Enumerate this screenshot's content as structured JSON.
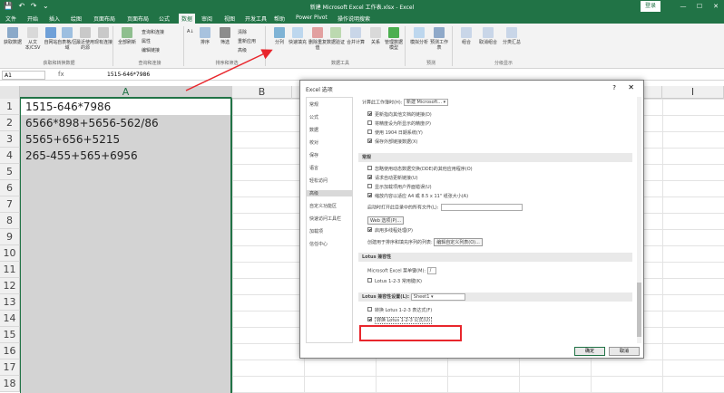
{
  "titlebar": {
    "quick_access": [
      "💾",
      "↶",
      "↷",
      "⌄"
    ],
    "title": "新建 Microsoft Excel 工作表.xlsx  -  Excel",
    "sign_in": "登录",
    "win_buttons": [
      "—",
      "☐",
      "✕"
    ]
  },
  "tabs": {
    "file": "文件",
    "home": "开始",
    "insert": "插入",
    "draw": "绘图",
    "layout": "页面布局",
    "formulas": "公式",
    "data": "数据",
    "review": "审阅",
    "view": "视图",
    "dev": "开发工具",
    "help": "帮助",
    "powerpivot": "Power Pivot",
    "tell": "操作说明搜索"
  },
  "ribbon": {
    "get_data": "获取数据",
    "from_text": "从文本/CSV",
    "from_web": "自网站",
    "from_table": "自表格/区域",
    "recent": "最近使用的源",
    "existing": "现有连接",
    "refresh_all": "全部刷新",
    "queries": "查询和连接",
    "properties": "属性",
    "edit_links": "编辑链接",
    "sort": "排序",
    "filter": "筛选",
    "clear": "清除",
    "reapply": "重新应用",
    "advanced": "高级",
    "text_to_columns": "分列",
    "flash_fill": "快速填充",
    "remove_dup": "删除重复值",
    "validation": "数据验证",
    "consolidate": "合并计算",
    "relationships": "关系",
    "data_model": "管理数据模型",
    "what_if": "模拟分析",
    "forecast_sheet": "预测工作表",
    "group": "组合",
    "ungroup": "取消组合",
    "subtotal": "分类汇总",
    "groups": {
      "get_transform": "获取和转换数据",
      "queries_conn": "查询和连接",
      "sort_filter": "排序和筛选",
      "data_tools": "数据工具",
      "forecast": "预测",
      "outline": "分级显示"
    }
  },
  "formula_bar": {
    "name_box": "A1",
    "fx": "fx",
    "formula": "1515-646*7986"
  },
  "sheet": {
    "columns": [
      "A",
      "B",
      "C",
      "D",
      "E",
      "F",
      "G",
      "H",
      "I"
    ],
    "rows": [
      "1",
      "2",
      "3",
      "4",
      "5",
      "6",
      "7",
      "8",
      "9",
      "10",
      "11",
      "12",
      "13",
      "14",
      "15",
      "16",
      "17",
      "18"
    ],
    "cells": [
      "1515-646*7986",
      "6566*898+5656-562/86",
      "5565+656+5215",
      "265-455+565+6956"
    ]
  },
  "dialog": {
    "title": "Excel 选项",
    "help": "?",
    "close": "✕",
    "nav": [
      "常规",
      "公式",
      "数据",
      "校对",
      "保存",
      "语言",
      "轻松访问",
      "高级",
      "自定义功能区",
      "快速访问工具栏",
      "加载项",
      "信任中心"
    ],
    "sections": {
      "calc_label": "计算此工作簿时(H):",
      "calc_book": "新建 Microsoft...",
      "calc_opts": [
        "更新指向其他文档的链接(D)",
        "将精度设为所显示的精度(P)",
        "使用 1904 日期系统(Y)",
        "保存外部链接数据(X)"
      ],
      "general": "常规",
      "general_opts": [
        "忽略使用动态数据交换(DDE)的其他应用程序(O)",
        "请求自动更新链接(U)",
        "显示加载项用户界面错误(U)",
        "缩放内容以适应 A4 或 8.5 x 11\" 纸张大小(A)"
      ],
      "startup_label": "启动时打开此目录中的所有文件(L):",
      "web_options": "Web 选项(P)...",
      "multithread": "启用多线程处理(P)",
      "custom_lists_label": "创建用于排序和填充序列的列表:",
      "custom_lists_btn": "编辑自定义列表(O)...",
      "lotus_compat": "Lotus 兼容性",
      "menu_key_label": "Microsoft Excel 菜单键(M):",
      "menu_key_val": "/",
      "lotus_nav": "Lotus 1-2-3 常用键(K)",
      "lotus_settings": "Lotus 兼容性设置(L):",
      "lotus_sheet": "Sheet1",
      "lotus_eval": "转换 Lotus 1-2-3 表达式(F)",
      "lotus_formula": "转换 Lotus 1-2-3 公式(U)"
    },
    "ok": "确定",
    "cancel": "取消"
  },
  "colors": {
    "accent": "#217346",
    "highlight": "#e8262c",
    "selection": "#d3d3d3"
  }
}
